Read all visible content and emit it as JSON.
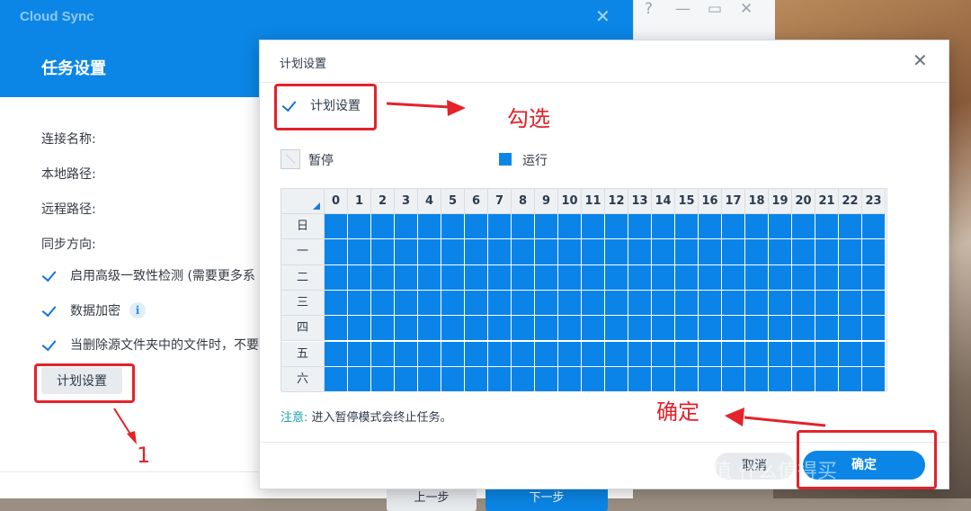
{
  "app": {
    "title": "Cloud Sync",
    "close": "✕"
  },
  "back_window": {
    "help": "?",
    "minimize": "—",
    "maximize": "▭",
    "close": "✕"
  },
  "main": {
    "page_title": "任务设置",
    "fields": [
      "连接名称:",
      "本地路径:",
      "远程路径:",
      "同步方向:"
    ],
    "options": [
      {
        "label": "启用高级一致性检测 (需要更多系",
        "checked": true
      },
      {
        "label": "数据加密",
        "checked": true,
        "info_icon": "info-icon"
      },
      {
        "label": "当删除源文件夹中的文件时，不要",
        "checked": true
      }
    ],
    "schedule_button": "计划设置",
    "prev_button": "上一步",
    "next_button": "下一步"
  },
  "dialog": {
    "title": "计划设置",
    "close": "✕",
    "schedule_checkbox": {
      "label": "计划设置",
      "checked": true
    },
    "legend_pause": "暂停",
    "legend_run": "运行",
    "hours": [
      "0",
      "1",
      "2",
      "3",
      "4",
      "5",
      "6",
      "7",
      "8",
      "9",
      "10",
      "11",
      "12",
      "13",
      "14",
      "15",
      "16",
      "17",
      "18",
      "19",
      "20",
      "21",
      "22",
      "23"
    ],
    "days": [
      "日",
      "一",
      "二",
      "三",
      "四",
      "五",
      "六"
    ],
    "all_running": true,
    "note_key": "注意:",
    "note_text": "进入暂停模式会终止任务。",
    "cancel_button": "取消",
    "ok_button": "确定"
  },
  "annotations": {
    "tick_label": "勾选",
    "confirm_label": "确定",
    "step_number": "1"
  },
  "watermark": "值 什么值得买",
  "colors": {
    "accent": "#0b86e6",
    "annotation": "#e3222a",
    "note": "#1aa3a8"
  }
}
